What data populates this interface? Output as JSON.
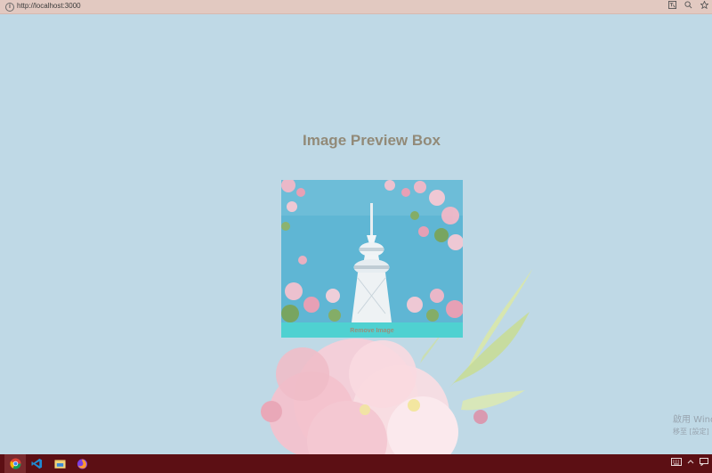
{
  "browser": {
    "url": "http://localhost:3000",
    "icons": [
      "translate-icon",
      "zoom-icon",
      "bookmark-star-icon"
    ]
  },
  "page": {
    "title": "Image Preview Box",
    "remove_label": "Remove Image"
  },
  "watermark": {
    "line1": "啟用 Windows",
    "line2": "移至 [設定] 以啟用"
  },
  "taskbar": {
    "apps": [
      "chrome-icon",
      "vscode-icon",
      "file-explorer-icon",
      "firefox-icon"
    ],
    "tray": [
      "keyboard-icon",
      "chevron-up-icon",
      "notification-icon"
    ]
  },
  "colors": {
    "background": "#bfd9e6",
    "title": "#928a78",
    "button": "#4fd1d1",
    "taskbar": "#5c0f14"
  }
}
